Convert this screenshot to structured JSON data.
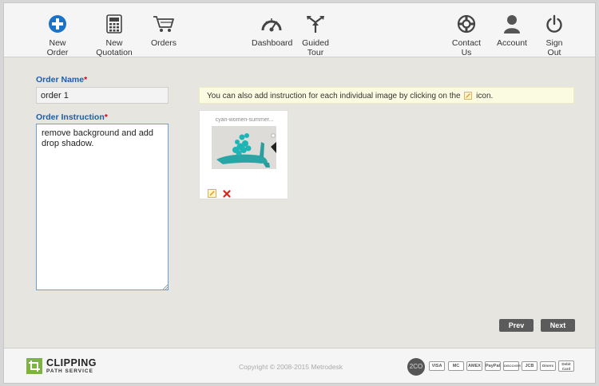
{
  "nav": {
    "new_order": "New Order",
    "new_quotation": "New Quotation",
    "orders": "Orders",
    "dashboard": "Dashboard",
    "guided_tour": "Guided Tour",
    "contact_us": "Contact Us",
    "account": "Account",
    "sign_out": "Sign Out"
  },
  "form": {
    "order_name_label": "Order Name",
    "order_name_value": "order 1",
    "order_instruction_label": "Order Instruction",
    "order_instruction_value": "remove background and add drop shadow.",
    "required_marker": "*"
  },
  "notice": {
    "text_before": "You can also add instruction for each individual image by clicking on the",
    "text_after": "icon."
  },
  "thumbnail": {
    "filename": "cyan-women-summer...",
    "edit_icon": "pencil-icon",
    "delete_icon": "delete-x-icon"
  },
  "buttons": {
    "prev": "Prev",
    "next": "Next"
  },
  "footer": {
    "logo_top": "CLIPPING",
    "logo_sub": "PATH SERVICE",
    "copyright": "Copyright © 2008-2015 Metrodesk",
    "payments": [
      "2CO",
      "VISA",
      "MC",
      "AMEX",
      "PayPal",
      "DISCOVER",
      "JCB",
      "Diners",
      "Debit Card"
    ]
  },
  "colors": {
    "accent_blue": "#1b5fa8",
    "required_red": "#d0021b",
    "button_dark": "#5b5b5b",
    "notice_bg": "#fbfbe1",
    "logo_green": "#7cb342"
  }
}
